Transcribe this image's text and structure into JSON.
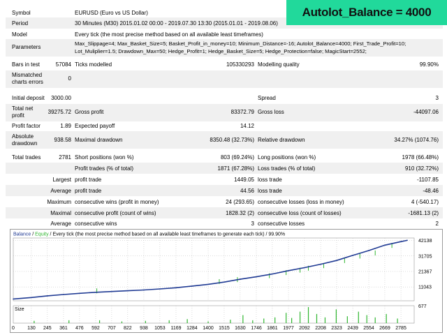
{
  "banner": {
    "text": "Autolot_Balance = 4000",
    "bg": "#21d99b"
  },
  "report": {
    "symbol_label": "Symbol",
    "symbol_value": "EURUSD (Euro vs US Dollar)",
    "period_label": "Period",
    "period_value": "30 Minutes (M30) 2015.01.02 00:00 - 2019.07.30 13:30 (2015.01.01 - 2019.08.06)",
    "model_label": "Model",
    "model_value": "Every tick (the most precise method based on all available least timeframes)",
    "params_label": "Parameters",
    "params_line1": "Max_Slippage=4; Max_Basket_Size=5; Basket_Profit_in_money=10; Minimum_Distance=-16; Autolot_Balance=4000; First_Trade_Profit=10;",
    "params_line2": "Lot_Muliplier=1.5; Drawdown_Max=50; Hedge_Profit=1; Hedge_Basket_Size=5; Hedge_Protection=false; MagicStart=2552;",
    "bars_label": "Bars in test",
    "bars_value": "57084",
    "ticks_label": "Ticks modelled",
    "ticks_value": "105330293",
    "quality_label": "Modelling quality",
    "quality_value": "99.90%",
    "mismatch_label_1": "Mismatched",
    "mismatch_label_2": "charts errors",
    "mismatch_value": "0",
    "deposit_label": "Initial deposit",
    "deposit_value": "3000.00",
    "spread_label": "Spread",
    "spread_value": "3",
    "netprofit_label_1": "Total net",
    "netprofit_label_2": "profit",
    "netprofit_value": "39275.72",
    "grossprofit_label": "Gross profit",
    "grossprofit_value": "83372.79",
    "grossloss_label": "Gross loss",
    "grossloss_value": "-44097.06",
    "pf_label": "Profit factor",
    "pf_value": "1.89",
    "payoff_label": "Expected payoff",
    "payoff_value": "14.12",
    "absdd_label_1": "Absolute",
    "absdd_label_2": "drawdown",
    "absdd_value": "938.58",
    "maxdd_label": "Maximal drawdown",
    "maxdd_value": "8350.48 (32.73%)",
    "reldd_label": "Relative drawdown",
    "reldd_value": "34.27% (1074.76)",
    "trades_label": "Total trades",
    "trades_value": "2781",
    "short_label": "Short positions (won %)",
    "short_value": "803 (69.24%)",
    "long_label": "Long positions (won %)",
    "long_value": "1978 (66.48%)",
    "ptrades_label": "Profit trades (% of total)",
    "ptrades_value": "1871 (67.28%)",
    "ltrades_label": "Loss trades (% of total)",
    "ltrades_value": "910 (32.72%)",
    "largest_label": "Largest",
    "profit_trade_label": "profit trade",
    "largest_profit_value": "1449.05",
    "loss_trade_label": "loss trade",
    "largest_loss_value": "-1107.85",
    "average_label": "Average",
    "avg_profit_value": "44.56",
    "avg_loss_value": "-48.46",
    "maximum_label": "Maximum",
    "max_cons_wins_label": "consecutive wins (profit in money)",
    "max_cons_wins_value": "24 (293.65)",
    "max_cons_losses_label": "consecutive losses (loss in money)",
    "max_cons_losses_value": "4 (-540.17)",
    "maximal_label": "Maximal",
    "maximal_cons_profit_label": "consecutive profit (count of wins)",
    "maximal_cons_profit_value": "1828.32 (2)",
    "maximal_cons_loss_label": "consecutive loss (count of losses)",
    "maximal_cons_loss_value": "-1681.13 (2)",
    "avg_cons_wins_label": "consecutive wins",
    "avg_cons_wins_value": "3",
    "avg_cons_losses_label": "consecutive losses",
    "avg_cons_losses_value": "2"
  },
  "chart_data": {
    "type": "line",
    "legend": {
      "balance": "Balance",
      "sep": " / ",
      "equity": "Equity",
      "rest": " / Every tick (the most precise method based on all available least timeframes to generate each tick) / 99.90%"
    },
    "colors": {
      "balance": "#1f3a93",
      "equity": "#2fb52f",
      "size": "#2fb52f",
      "grid": "#b8b8b8"
    },
    "x_ticks": [
      0,
      130,
      245,
      361,
      476,
      592,
      707,
      822,
      938,
      1053,
      1169,
      1284,
      1400,
      1515,
      1630,
      1746,
      1861,
      1977,
      2092,
      2208,
      2323,
      2439,
      2554,
      2669,
      2785
    ],
    "y_ticks": [
      11043,
      21367,
      31705,
      42138
    ],
    "xlim": [
      0,
      2880
    ],
    "ylim": [
      1800,
      43700
    ],
    "series": [
      {
        "name": "Balance",
        "x": [
          0,
          130,
          245,
          361,
          476,
          592,
          707,
          822,
          938,
          1053,
          1169,
          1284,
          1400,
          1515,
          1630,
          1746,
          1861,
          1977,
          2092,
          2208,
          2323,
          2439,
          2554,
          2669,
          2785,
          2830
        ],
        "values": [
          3000,
          4000,
          5100,
          6000,
          6800,
          7500,
          8000,
          8500,
          9000,
          9700,
          10500,
          11600,
          12800,
          14300,
          16200,
          17800,
          19700,
          21900,
          23900,
          26200,
          28700,
          32100,
          35300,
          38900,
          41300,
          42138
        ]
      },
      {
        "name": "Equity",
        "x": [
          600,
          1480,
          1610,
          1840,
          1960,
          2060,
          2120,
          2230,
          2380,
          2490,
          2600,
          2720
        ],
        "values": [
          6800,
          13000,
          14300,
          16900,
          19000,
          20600,
          21900,
          23600,
          27000,
          30000,
          32100,
          37100
        ]
      }
    ],
    "size_panel": {
      "label": "Size",
      "y_tick": "677",
      "x": [
        150,
        400,
        620,
        780,
        950,
        1120,
        1250,
        1400,
        1560,
        1650,
        1720,
        1800,
        1880,
        1960,
        2000,
        2060,
        2120,
        2180,
        2240,
        2320,
        2400,
        2480,
        2540,
        2600,
        2680,
        2760
      ],
      "values": [
        4,
        5,
        5,
        3,
        4,
        5,
        7,
        3,
        6,
        14,
        5,
        8,
        10,
        18,
        9,
        20,
        28,
        16,
        10,
        24,
        12,
        20,
        14,
        10,
        16,
        8
      ]
    }
  }
}
